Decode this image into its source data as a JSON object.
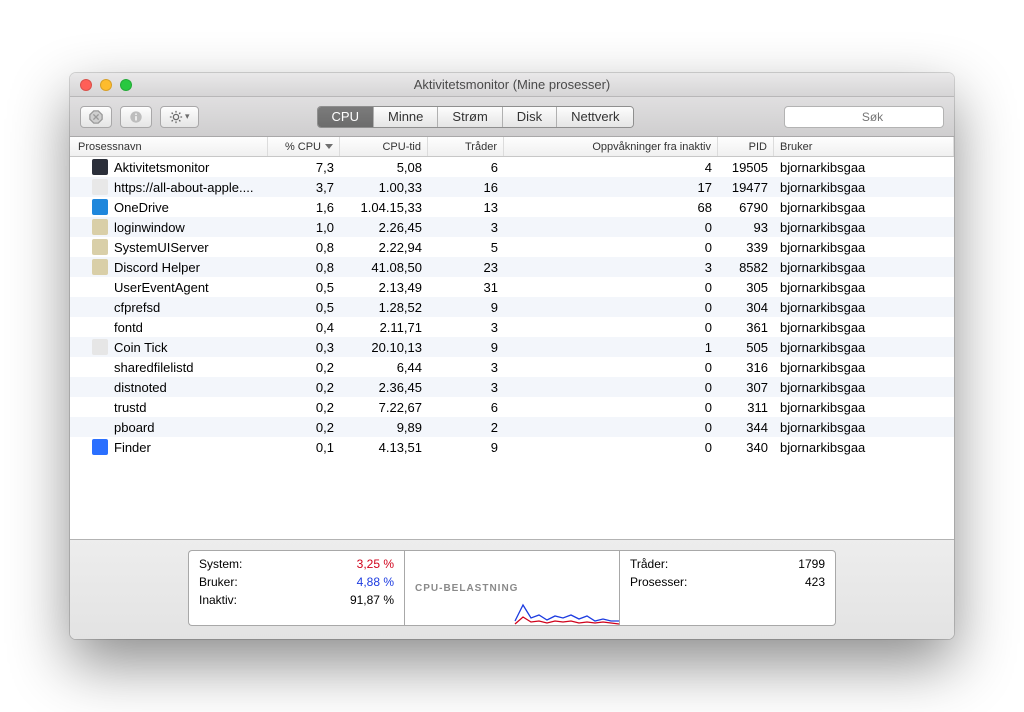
{
  "window": {
    "title": "Aktivitetsmonitor (Mine prosesser)"
  },
  "search": {
    "placeholder": "Søk"
  },
  "tabs": [
    {
      "label": "CPU",
      "selected": true
    },
    {
      "label": "Minne",
      "selected": false
    },
    {
      "label": "Strøm",
      "selected": false
    },
    {
      "label": "Disk",
      "selected": false
    },
    {
      "label": "Nettverk",
      "selected": false
    }
  ],
  "columns": {
    "name": "Prosessnavn",
    "cpu": "% CPU",
    "time": "CPU-tid",
    "threads": "Tråder",
    "wakeups": "Oppvåkninger fra inaktiv",
    "pid": "PID",
    "user": "Bruker"
  },
  "rows": [
    {
      "icon": "#2b2f3a",
      "name": "Aktivitetsmonitor",
      "cpu": "7,3",
      "time": "5,08",
      "threads": "6",
      "wakeups": "4",
      "pid": "19505",
      "user": "bjornarkibsgaa"
    },
    {
      "icon": "#e8e8e8",
      "name": "https://all-about-apple....",
      "cpu": "3,7",
      "time": "1.00,33",
      "threads": "16",
      "wakeups": "17",
      "pid": "19477",
      "user": "bjornarkibsgaa"
    },
    {
      "icon": "#1f87dc",
      "name": "OneDrive",
      "cpu": "1,6",
      "time": "1.04.15,33",
      "threads": "13",
      "wakeups": "68",
      "pid": "6790",
      "user": "bjornarkibsgaa"
    },
    {
      "icon": "#d9cfa8",
      "name": "loginwindow",
      "cpu": "1,0",
      "time": "2.26,45",
      "threads": "3",
      "wakeups": "0",
      "pid": "93",
      "user": "bjornarkibsgaa"
    },
    {
      "icon": "#d9cfa8",
      "name": "SystemUIServer",
      "cpu": "0,8",
      "time": "2.22,94",
      "threads": "5",
      "wakeups": "0",
      "pid": "339",
      "user": "bjornarkibsgaa"
    },
    {
      "icon": "#d9cfa8",
      "name": "Discord Helper",
      "cpu": "0,8",
      "time": "41.08,50",
      "threads": "23",
      "wakeups": "3",
      "pid": "8582",
      "user": "bjornarkibsgaa"
    },
    {
      "icon": "",
      "name": "UserEventAgent",
      "cpu": "0,5",
      "time": "2.13,49",
      "threads": "31",
      "wakeups": "0",
      "pid": "305",
      "user": "bjornarkibsgaa"
    },
    {
      "icon": "",
      "name": "cfprefsd",
      "cpu": "0,5",
      "time": "1.28,52",
      "threads": "9",
      "wakeups": "0",
      "pid": "304",
      "user": "bjornarkibsgaa"
    },
    {
      "icon": "",
      "name": "fontd",
      "cpu": "0,4",
      "time": "2.11,71",
      "threads": "3",
      "wakeups": "0",
      "pid": "361",
      "user": "bjornarkibsgaa"
    },
    {
      "icon": "#e6e6e6",
      "name": "Coin Tick",
      "cpu": "0,3",
      "time": "20.10,13",
      "threads": "9",
      "wakeups": "1",
      "pid": "505",
      "user": "bjornarkibsgaa"
    },
    {
      "icon": "",
      "name": "sharedfilelistd",
      "cpu": "0,2",
      "time": "6,44",
      "threads": "3",
      "wakeups": "0",
      "pid": "316",
      "user": "bjornarkibsgaa"
    },
    {
      "icon": "",
      "name": "distnoted",
      "cpu": "0,2",
      "time": "2.36,45",
      "threads": "3",
      "wakeups": "0",
      "pid": "307",
      "user": "bjornarkibsgaa"
    },
    {
      "icon": "",
      "name": "trustd",
      "cpu": "0,2",
      "time": "7.22,67",
      "threads": "6",
      "wakeups": "0",
      "pid": "311",
      "user": "bjornarkibsgaa"
    },
    {
      "icon": "",
      "name": "pboard",
      "cpu": "0,2",
      "time": "9,89",
      "threads": "2",
      "wakeups": "0",
      "pid": "344",
      "user": "bjornarkibsgaa"
    },
    {
      "icon": "#2a6fff",
      "name": "Finder",
      "cpu": "0,1",
      "time": "4.13,51",
      "threads": "9",
      "wakeups": "0",
      "pid": "340",
      "user": "bjornarkibsgaa"
    }
  ],
  "footer": {
    "left": {
      "system_label": "System:",
      "system_value": "3,25 %",
      "user_label": "Bruker:",
      "user_value": "4,88 %",
      "idle_label": "Inaktiv:",
      "idle_value": "91,87 %"
    },
    "mid_label": "CPU-BELASTNING",
    "right": {
      "threads_label": "Tråder:",
      "threads_value": "1799",
      "processes_label": "Prosesser:",
      "processes_value": "423"
    }
  }
}
